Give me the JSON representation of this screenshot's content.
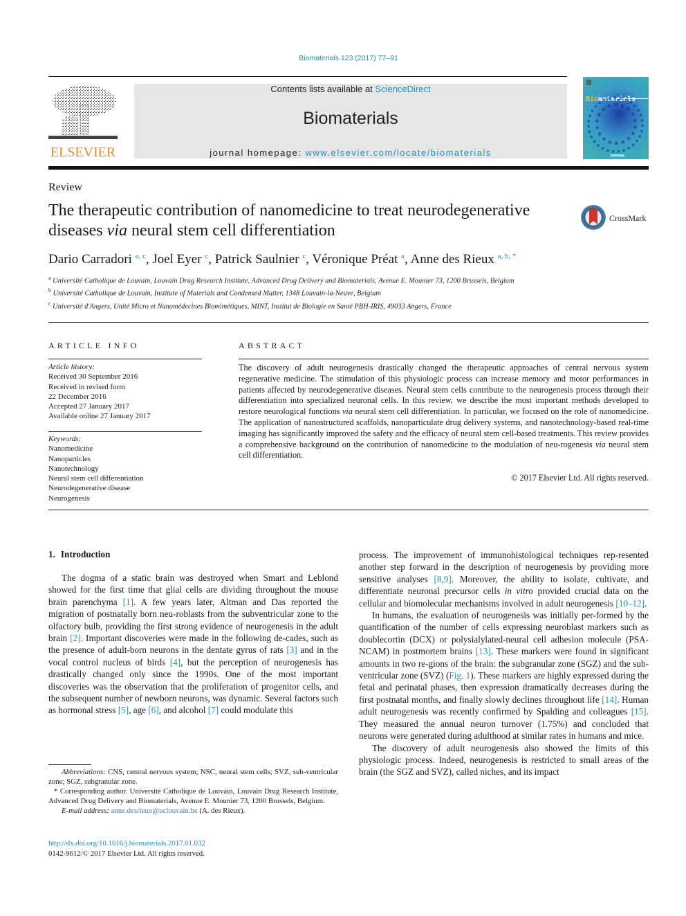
{
  "header": {
    "journal_ref": "Biomaterials 123 (2017) 77–91",
    "contents_prefix": "Contents lists available at ",
    "contents_link": "ScienceDirect",
    "journal_name": "Biomaterials",
    "homepage_prefix": "journal homepage: ",
    "homepage_link": "www.elsevier.com/locate/biomaterials",
    "publisher_logo_text": "ELSEVIER",
    "cover_title_highlight": "Bio",
    "cover_title_rest": "materials",
    "colors": {
      "link": "#2a8bb5",
      "elsevier_orange": "#f08a1c",
      "banner_bg": "#e6e6e6"
    }
  },
  "article": {
    "type": "Review",
    "title_part1": "The therapeutic contribution of nanomedicine to treat neurodegenerative diseases ",
    "title_italic": "via",
    "title_part2": " neural stem cell differentiation",
    "crossmark_label": "CrossMark",
    "authors": [
      {
        "name": "Dario Carradori",
        "sup": "a, c",
        "sep": ", "
      },
      {
        "name": "Joel Eyer",
        "sup": "c",
        "sep": ", "
      },
      {
        "name": "Patrick Saulnier",
        "sup": "c",
        "sep": ", "
      },
      {
        "name": "Véronique Préat",
        "sup": "a",
        "sep": ", "
      },
      {
        "name": "Anne des Rieux",
        "sup": "a, b, *",
        "sep": ""
      }
    ],
    "affiliations": [
      {
        "key": "a",
        "text": "Université Catholique de Louvain, Louvain Drug Research Institute, Advanced Drug Delivery and Biomaterials, Avenue E. Mounier 73, 1200 Brussels, Belgium"
      },
      {
        "key": "b",
        "text": "Université Catholique de Louvain, Institute of Materials and Condensed Matter, 1348 Louvain-la-Neuve, Belgium"
      },
      {
        "key": "c",
        "text": "Université d'Angers, Unité Micro et Nanomédecines Biomimétiques, MINT, Institut de Biologie en Santé PBH-IRIS, 49033 Angers, France"
      }
    ]
  },
  "article_info": {
    "heading": "ARTICLE INFO",
    "history_label": "Article history:",
    "history": [
      "Received 30 September 2016",
      "Received in revised form",
      "22 December 2016",
      "Accepted 27 January 2017",
      "Available online 27 January 2017"
    ],
    "keywords_label": "Keywords:",
    "keywords": [
      "Nanomedicine",
      "Nanoparticles",
      "Nanotechnology",
      "Neural stem cell differentiation",
      "Neurodegenerative disease",
      "Neurogenesis"
    ]
  },
  "abstract": {
    "heading": "ABSTRACT",
    "seg1": "The discovery of adult neurogenesis drastically changed the therapeutic approaches of central nervous system regenerative medicine. The stimulation of this physiologic process can increase memory and motor performances in patients affected by neurodegenerative diseases. Neural stem cells contribute to the neurogenesis process through their differentiation into specialized neuronal cells. In this review, we describe the most important methods developed to restore neurological functions ",
    "via1": "via",
    "seg2": " neural stem cell differentiation. In particular, we focused on the role of nanomedicine. The application of nanostructured scaffolds, nanoparticulate drug delivery systems, and nanotechnology-based real-time imaging has significantly improved the safety and the efficacy of neural stem cell-based treatments. This review provides a comprehensive background on the contribution of nanomedicine to the modulation of neu-rogenesis ",
    "via2": "via",
    "seg3": " neural stem cell differentiation.",
    "copyright": "© 2017 Elsevier Ltd. All rights reserved."
  },
  "body": {
    "section_number": "1.",
    "section_title": "Introduction",
    "left": {
      "t1": "The dogma of a static brain was destroyed when Smart and Leblond showed for the first time that glial cells are dividing throughout the mouse brain parenchyma ",
      "r1": "[1]",
      "t2": ". A few years later, Altman and Das reported the migration of postnatally born neu-roblasts from the subventricular zone to the olfactory bulb, providing the first strong evidence of neurogenesis in the adult brain ",
      "r2": "[2]",
      "t3": ". Important discoveries were made in the following de-cades, such as the presence of adult-born neurons in the dentate gyrus of rats ",
      "r3": "[3]",
      "t4": " and in the vocal control nucleus of birds ",
      "r4": "[4]",
      "t5": ", but the perception of neurogenesis has drastically changed only since the 1990s. One of the most important discoveries was the observation that the proliferation of progenitor cells, and the subsequent number of newborn neurons, was dynamic. Several factors such as hormonal stress ",
      "r5": "[5]",
      "t6": ", age ",
      "r6": "[6]",
      "t7": ", and alcohol ",
      "r7": "[7]",
      "t8": " could modulate this"
    },
    "right": {
      "p1_t1": "process. The improvement of immunohistological techniques rep-resented another step forward in the description of neurogenesis by providing more sensitive analyses ",
      "p1_r1": "[8,9]",
      "p1_t2": ". Moreover, the ability to isolate, cultivate, and differentiate neuronal precursor cells ",
      "p1_it": "in vitro",
      "p1_t3": " provided crucial data on the cellular and biomolecular mechanisms involved in adult neurogenesis ",
      "p1_r2": "[10–12]",
      "p1_t4": ".",
      "p2_t1": "In humans, the evaluation of neurogenesis was initially per-formed by the quantification of the number of cells expressing neuroblast markers such as doublecortin (DCX) or polysialylated-neural cell adhesion molecule (PSA-NCAM) in postmortem brains ",
      "p2_r1": "[13]",
      "p2_t2": ". These markers were found in significant amounts in two re-gions of the brain: the subgranular zone (SGZ) and the sub-ventricular zone (SVZ) (",
      "p2_r2": "Fig. 1",
      "p2_t3": "). These markers are highly expressed during the fetal and perinatal phases, then expression dramatically decreases during the first postnatal months, and finally slowly declines throughout life ",
      "p2_r3": "[14]",
      "p2_t4": ". Human adult neurogenesis was recently confirmed by Spalding and colleagues ",
      "p2_r4": "[15]",
      "p2_t5": ". They measured the annual neuron turnover (1.75%) and concluded that neurons were generated during adulthood at similar rates in humans and mice.",
      "p3": "The discovery of adult neurogenesis also showed the limits of this physiologic process. Indeed, neurogenesis is restricted to small areas of the brain (the SGZ and SVZ), called niches, and its impact"
    }
  },
  "footnotes": {
    "abbrev_label": "Abbreviations:",
    "abbrev_text": " CNS, central nervous system; NSC, neural stem cells; SVZ, sub-ventricular zone; SGZ, subgranular zone.",
    "corresponding": "* Corresponding author. Université Catholique de Louvain, Louvain Drug Research Institute, Advanced Drug Delivery and Biomaterials, Avenue E. Mounier 73, 1200 Brussels, Belgium.",
    "email_label": "E-mail address:",
    "email": "anne.desrieux@uclouvain.be",
    "email_suffix": " (A. des Rieux).",
    "doi": "http://dx.doi.org/10.1016/j.biomaterials.2017.01.032",
    "issn": "0142-9612/© 2017 Elsevier Ltd. All rights reserved."
  }
}
